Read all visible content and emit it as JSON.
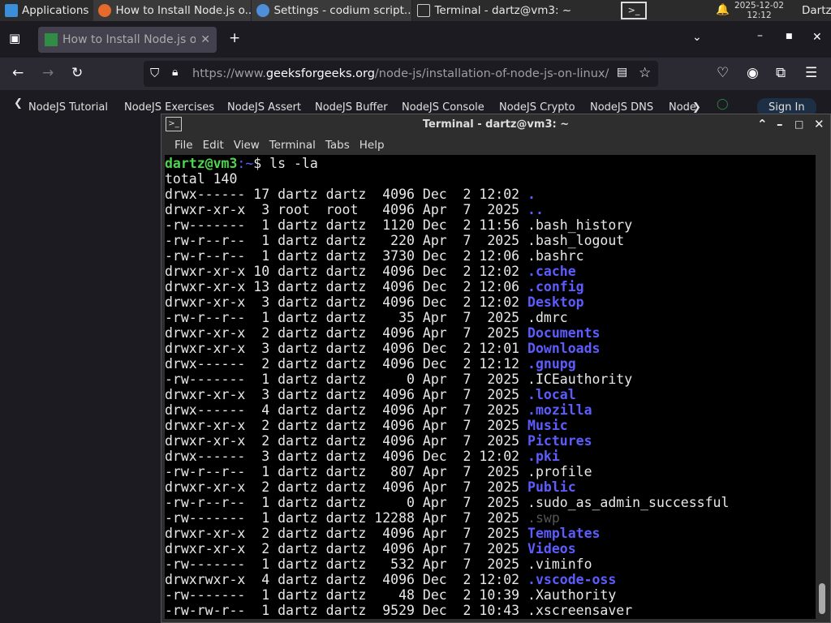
{
  "taskbar": {
    "apps": "Applications",
    "tasks": [
      "How to Install Node.js o...",
      "Settings - codium script...",
      "Terminal - dartz@vm3: ~"
    ],
    "date": "2025-12-02",
    "time": "12:12",
    "user": "Dartz"
  },
  "browser": {
    "tab_title": "How to Install Node.js on",
    "url_prefix": "https://www.",
    "url_domain": "geeksforgeeks.org",
    "url_path": "/node-js/installation-of-node-js-on-linux/",
    "bookmarks": [
      "NodeJS Tutorial",
      "NodeJS Exercises",
      "NodeJS Assert",
      "NodeJS Buffer",
      "NodeJS Console",
      "NodeJS Crypto",
      "NodeJS DNS",
      "Node"
    ],
    "signin": "Sign In"
  },
  "terminal": {
    "title": "Terminal - dartz@vm3: ~",
    "menu": [
      "File",
      "Edit",
      "View",
      "Terminal",
      "Tabs",
      "Help"
    ],
    "prompt_user": "dartz@vm3",
    "prompt_path": ":~",
    "prompt_cmd": "$ ls -la",
    "total": "total 140",
    "colors": {
      "dir": "#5c5cff",
      "prompt": "#4fd44f"
    },
    "lines": [
      {
        "info": "drwx------ 17 dartz dartz  4096 Dec  2 12:02 ",
        "name": ".",
        "type": "dir"
      },
      {
        "info": "drwxr-xr-x  3 root  root   4096 Apr  7  2025 ",
        "name": "..",
        "type": "dir"
      },
      {
        "info": "-rw-------  1 dartz dartz  1120 Dec  2 11:56 ",
        "name": ".bash_history",
        "type": "file"
      },
      {
        "info": "-rw-r--r--  1 dartz dartz   220 Apr  7  2025 ",
        "name": ".bash_logout",
        "type": "file"
      },
      {
        "info": "-rw-r--r--  1 dartz dartz  3730 Dec  2 12:06 ",
        "name": ".bashrc",
        "type": "file"
      },
      {
        "info": "drwxr-xr-x 10 dartz dartz  4096 Dec  2 12:02 ",
        "name": ".cache",
        "type": "dir"
      },
      {
        "info": "drwxr-xr-x 13 dartz dartz  4096 Dec  2 12:06 ",
        "name": ".config",
        "type": "dir"
      },
      {
        "info": "drwxr-xr-x  3 dartz dartz  4096 Dec  2 12:02 ",
        "name": "Desktop",
        "type": "dir"
      },
      {
        "info": "-rw-r--r--  1 dartz dartz    35 Apr  7  2025 ",
        "name": ".dmrc",
        "type": "file"
      },
      {
        "info": "drwxr-xr-x  2 dartz dartz  4096 Apr  7  2025 ",
        "name": "Documents",
        "type": "dir"
      },
      {
        "info": "drwxr-xr-x  3 dartz dartz  4096 Dec  2 12:01 ",
        "name": "Downloads",
        "type": "dir"
      },
      {
        "info": "drwx------  2 dartz dartz  4096 Dec  2 12:12 ",
        "name": ".gnupg",
        "type": "dir"
      },
      {
        "info": "-rw-------  1 dartz dartz     0 Apr  7  2025 ",
        "name": ".ICEauthority",
        "type": "file"
      },
      {
        "info": "drwxr-xr-x  3 dartz dartz  4096 Apr  7  2025 ",
        "name": ".local",
        "type": "dir"
      },
      {
        "info": "drwx------  4 dartz dartz  4096 Apr  7  2025 ",
        "name": ".mozilla",
        "type": "dir"
      },
      {
        "info": "drwxr-xr-x  2 dartz dartz  4096 Apr  7  2025 ",
        "name": "Music",
        "type": "dir"
      },
      {
        "info": "drwxr-xr-x  2 dartz dartz  4096 Apr  7  2025 ",
        "name": "Pictures",
        "type": "dir"
      },
      {
        "info": "drwx------  3 dartz dartz  4096 Dec  2 12:02 ",
        "name": ".pki",
        "type": "dir"
      },
      {
        "info": "-rw-r--r--  1 dartz dartz   807 Apr  7  2025 ",
        "name": ".profile",
        "type": "file"
      },
      {
        "info": "drwxr-xr-x  2 dartz dartz  4096 Apr  7  2025 ",
        "name": "Public",
        "type": "dir"
      },
      {
        "info": "-rw-r--r--  1 dartz dartz     0 Apr  7  2025 ",
        "name": ".sudo_as_admin_successful",
        "type": "file"
      },
      {
        "info": "-rw-------  1 dartz dartz 12288 Apr  7  2025 ",
        "name": ".swp",
        "type": "dim"
      },
      {
        "info": "drwxr-xr-x  2 dartz dartz  4096 Apr  7  2025 ",
        "name": "Templates",
        "type": "dir"
      },
      {
        "info": "drwxr-xr-x  2 dartz dartz  4096 Apr  7  2025 ",
        "name": "Videos",
        "type": "dir"
      },
      {
        "info": "-rw-------  1 dartz dartz   532 Apr  7  2025 ",
        "name": ".viminfo",
        "type": "file"
      },
      {
        "info": "drwxrwxr-x  4 dartz dartz  4096 Dec  2 12:02 ",
        "name": ".vscode-oss",
        "type": "dir"
      },
      {
        "info": "-rw-------  1 dartz dartz    48 Dec  2 10:39 ",
        "name": ".Xauthority",
        "type": "file"
      },
      {
        "info": "-rw-rw-r--  1 dartz dartz  9529 Dec  2 10:43 ",
        "name": ".xscreensaver",
        "type": "file"
      }
    ]
  }
}
